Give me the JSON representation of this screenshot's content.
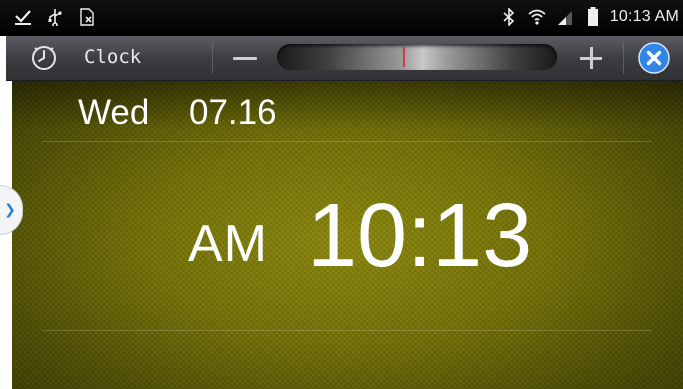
{
  "status_bar": {
    "icons_left": [
      "download-complete-icon",
      "usb-icon",
      "sim-card-icon"
    ],
    "icons_right": [
      "bluetooth-icon",
      "wifi-icon",
      "signal-icon",
      "battery-icon"
    ],
    "time": "10:13 AM"
  },
  "title_bar": {
    "app_icon": "clock-icon",
    "app_name": "Clock",
    "transparency_level": 0.45,
    "buttons": {
      "decrease": "minus-icon",
      "increase": "plus-icon",
      "close": "close-icon"
    }
  },
  "clock": {
    "day": "Wed",
    "date": "07.16",
    "ampm": "AM",
    "time": "10:13"
  },
  "colors": {
    "panel": "#747206",
    "close_button": "#2f86e8",
    "slider_marker": "#d23b4a"
  }
}
